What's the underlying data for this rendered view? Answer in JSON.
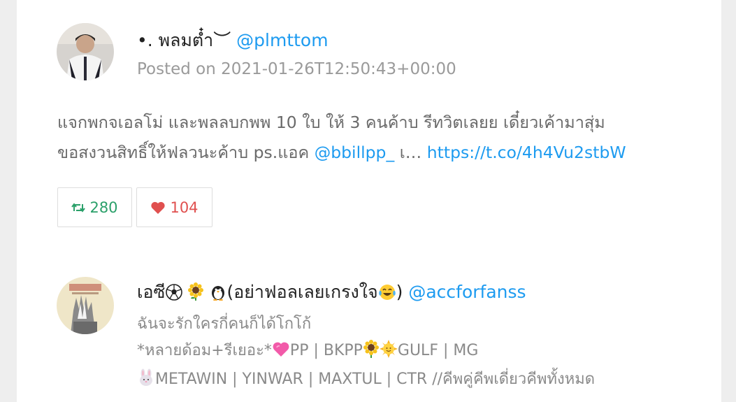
{
  "tweet": {
    "display_name": "•. พลมต๋ำ︶",
    "handle": "@plmttom",
    "posted_prefix": "Posted on",
    "posted_at": "2021-01-26T12:50:43+00:00",
    "text_line1": "แจกพกจเอลโม่ และพลลบกพพ 10 ใบ ให้ 3 คนค้าบ รีทวิตเลยย เดี๋ยวเค้ามาสุ่ม",
    "text_line2_prefix": "ขอสงวนสิทธิ์ให้ฟลวนะค้าบ ps.แอค",
    "text_mention": "@bbillpp_",
    "text_ellipsis": "เ…",
    "text_link": "https://t.co/4h4Vu2stbW",
    "retweet_count": "280",
    "like_count": "104",
    "colors": {
      "link": "#1d9bf0",
      "retweet": "#2ba06a",
      "like": "#e0504f"
    }
  },
  "user": {
    "display_name_prefix": "เอซี",
    "display_name_text": "(อย่าฟอลเลยเกรงใจ",
    "display_name_close": ")",
    "handle": "@accforfanss",
    "bio_line1": "ฉันจะรักใครกี่คนก็ได้โกโก้",
    "bio_line2_a": "*หลายด้อม+รีเยอะ*",
    "bio_line2_b": "PP | BKPP",
    "bio_line2_c": "GULF | MG",
    "bio_line3": "METAWIN | YINWAR | MAXTUL | CTR //คีพคู่คีพเดี่ยวคีพทั้งหมด",
    "emoji_icons": [
      "soccer-ball-icon",
      "sunflower-icon",
      "penguin-icon",
      "tears-of-joy-icon",
      "pink-heart-icon",
      "sunflower-icon",
      "sun-face-icon",
      "rabbit-face-icon"
    ]
  }
}
